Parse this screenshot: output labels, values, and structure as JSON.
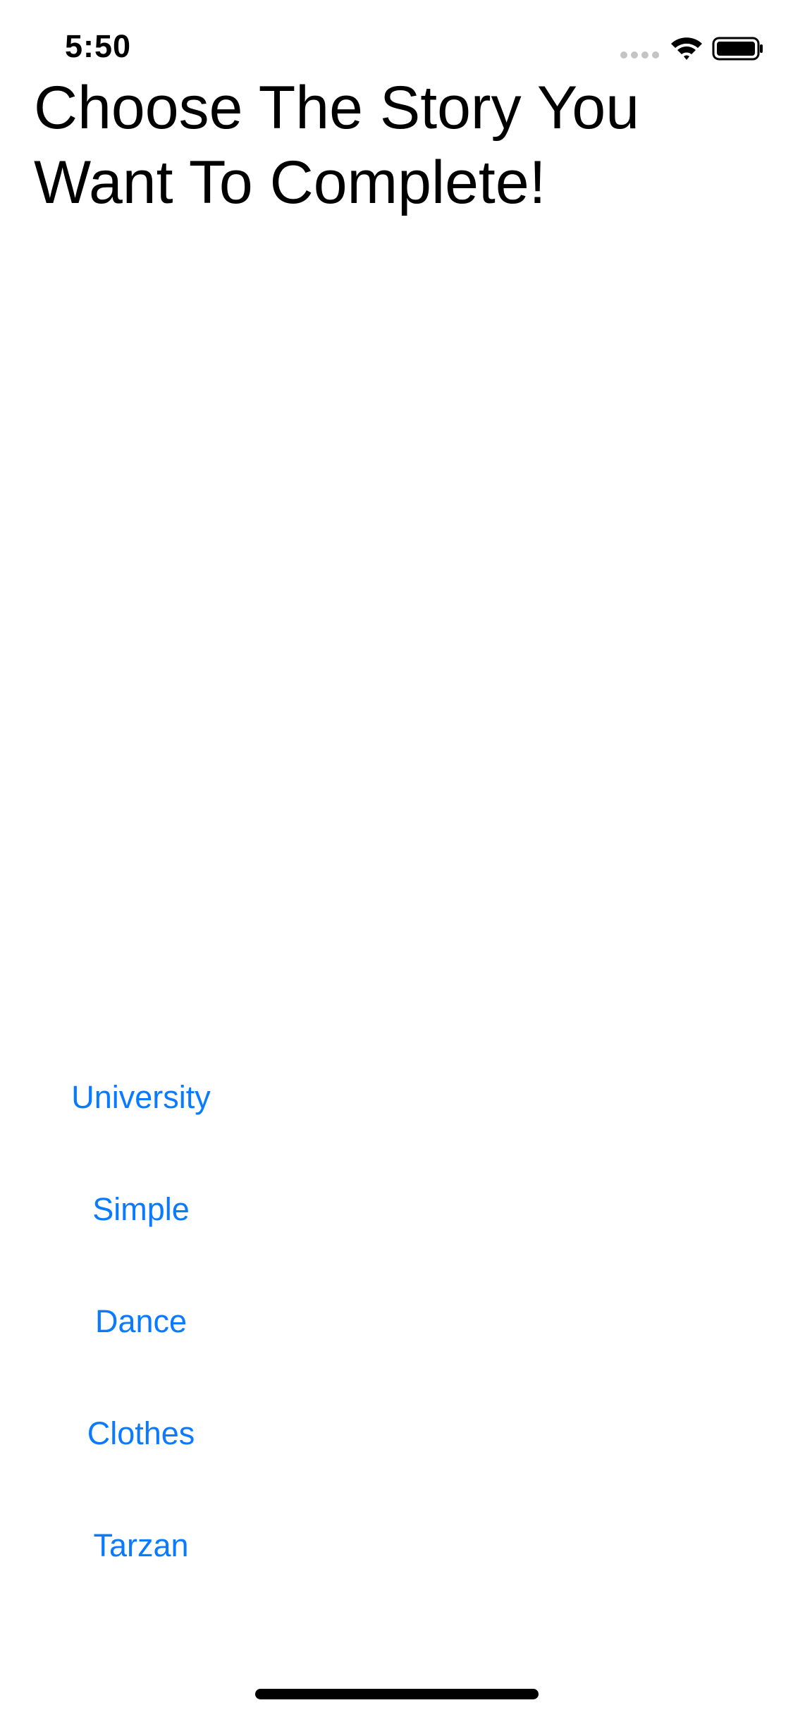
{
  "status_bar": {
    "time": "5:50",
    "icons": [
      "signal-icon",
      "wifi-icon",
      "battery-icon"
    ]
  },
  "title": "Choose The Story You Want To Complete!",
  "stories": [
    {
      "label": "University"
    },
    {
      "label": "Simple"
    },
    {
      "label": "Dance"
    },
    {
      "label": "Clothes"
    },
    {
      "label": "Tarzan"
    }
  ],
  "colors": {
    "accent": "#0A7AFF",
    "text": "#000000",
    "background": "#FFFFFF"
  }
}
